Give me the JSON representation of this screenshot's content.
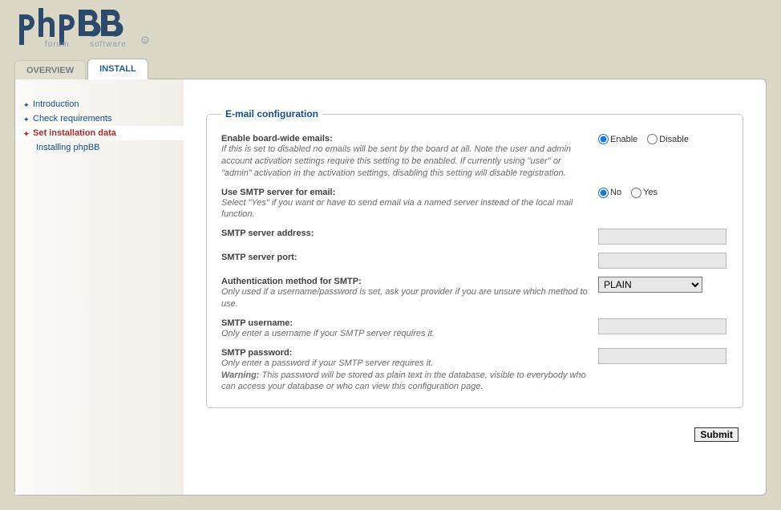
{
  "brand": {
    "name": "phpBB",
    "tagline": "forum software"
  },
  "tabs": [
    {
      "label": "OVERVIEW",
      "active": false
    },
    {
      "label": "INSTALL",
      "active": true
    }
  ],
  "sidebar": {
    "items": [
      {
        "label": "Introduction",
        "active": false,
        "sub": false
      },
      {
        "label": "Check requirements",
        "active": false,
        "sub": false
      },
      {
        "label": "Set installation data",
        "active": true,
        "sub": false
      },
      {
        "label": "Installing phpBB",
        "active": false,
        "sub": true
      }
    ]
  },
  "form": {
    "legend": "E-mail configuration",
    "fields": {
      "enable_emails": {
        "label": "Enable board-wide emails:",
        "hint": "If this is set to disabled no emails will be sent by the board at all. Note the user and admin account activation settings require this setting to be enabled. If currently using \"user\" or \"admin\" activation in the activation settings, disabling this setting will disable registration.",
        "option_a": "Enable",
        "option_b": "Disable",
        "value": "Enable"
      },
      "use_smtp": {
        "label": "Use SMTP server for email:",
        "hint": "Select \"Yes\" if you want or have to send email via a named server instead of the local mail function.",
        "option_a": "No",
        "option_b": "Yes",
        "value": "No"
      },
      "smtp_address": {
        "label": "SMTP server address:",
        "value": ""
      },
      "smtp_port": {
        "label": "SMTP server port:",
        "value": ""
      },
      "smtp_auth": {
        "label": "Authentication method for SMTP:",
        "hint": "Only used if a username/password is set, ask your provider if you are unsure which method to use.",
        "value": "PLAIN",
        "options": [
          "PLAIN"
        ]
      },
      "smtp_user": {
        "label": "SMTP username:",
        "hint": "Only enter a username if your SMTP server requires it.",
        "value": ""
      },
      "smtp_pass": {
        "label": "SMTP password:",
        "hint_a": "Only enter a password if your SMTP server requires it.",
        "warn_label": "Warning:",
        "hint_b": " This password will be stored as plain text in the database, visible to everybody who can access your database or who can view this configuration page.",
        "value": ""
      }
    },
    "submit": "Submit"
  }
}
